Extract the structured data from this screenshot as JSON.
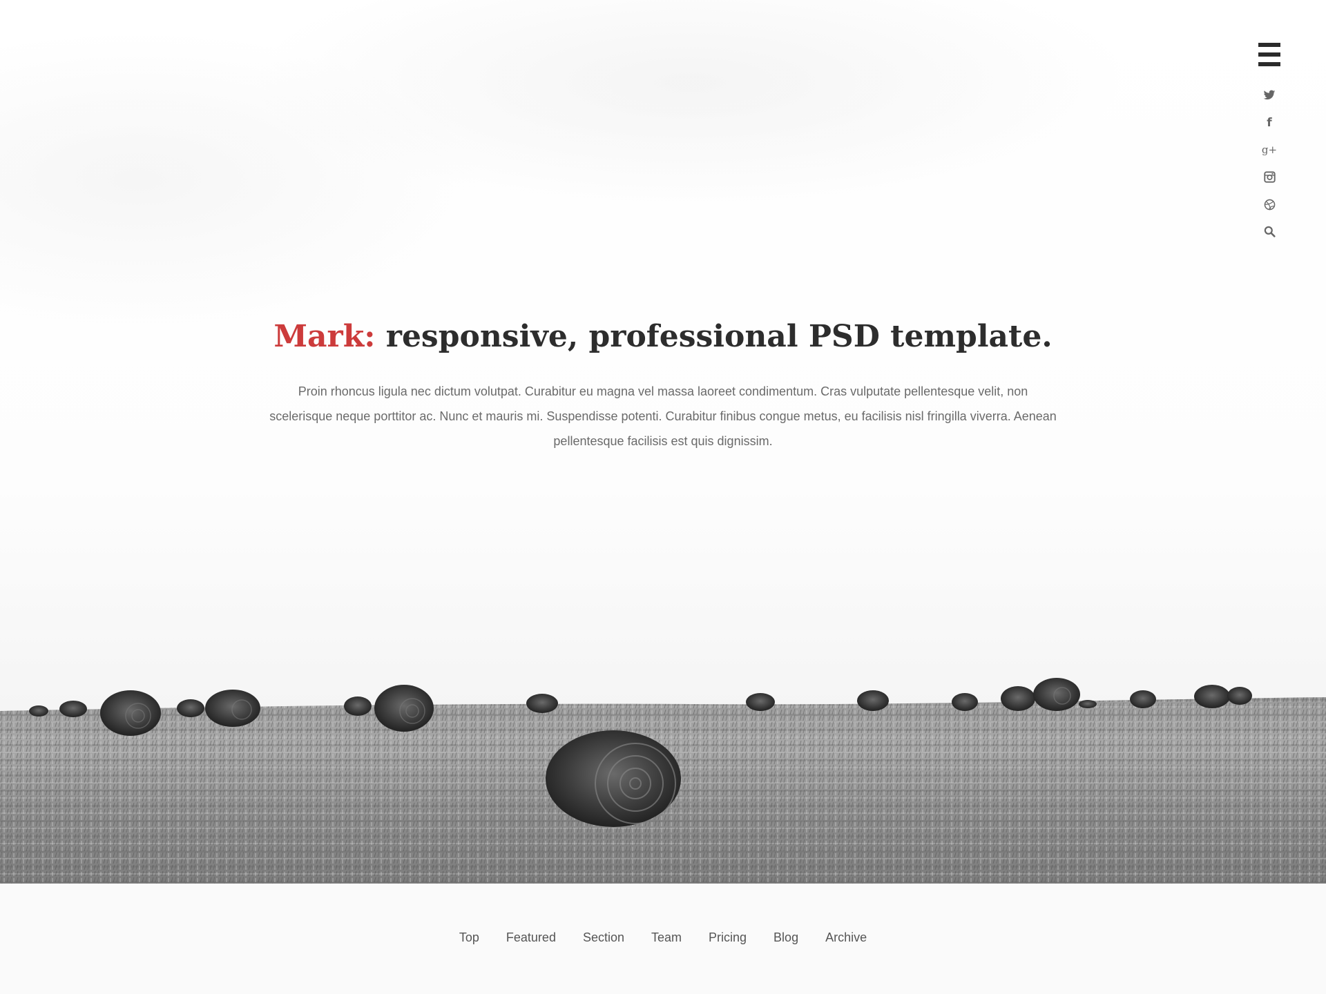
{
  "hero": {
    "title_accent": "Mark:",
    "title_rest": " responsive, professional PSD template.",
    "lead": "Proin rhoncus ligula nec dictum volutpat. Curabitur eu magna vel massa laoreet condimentum. Cras vulputate pellentesque velit, non scelerisque neque porttitor ac. Nunc et mauris mi. Suspendisse potenti. Curabitur finibus congue metus, eu facilisis nisl fringilla viverra. Aenean pellentesque facilisis est quis dignissim.",
    "background": "black-and-white photo of hay bales in a field"
  },
  "colors": {
    "accent": "#cc3b3b",
    "heading": "#2d2d2d",
    "body_text": "#6a6a6a",
    "icon": "#666666",
    "menu_icon": "#2b2b2b",
    "footer_bg": "#fafafa"
  },
  "header": {
    "menu_icon": "hamburger-menu-icon",
    "social_icons": [
      "twitter-icon",
      "facebook-icon",
      "google-plus-icon",
      "instagram-icon",
      "dribbble-icon",
      "search-icon"
    ],
    "facebook_glyph": "f",
    "googleplus_glyph": "g+"
  },
  "footer_nav": {
    "items": [
      {
        "label": "Top"
      },
      {
        "label": "Featured"
      },
      {
        "label": "Section"
      },
      {
        "label": "Team"
      },
      {
        "label": "Pricing"
      },
      {
        "label": "Blog"
      },
      {
        "label": "Archive"
      }
    ]
  }
}
